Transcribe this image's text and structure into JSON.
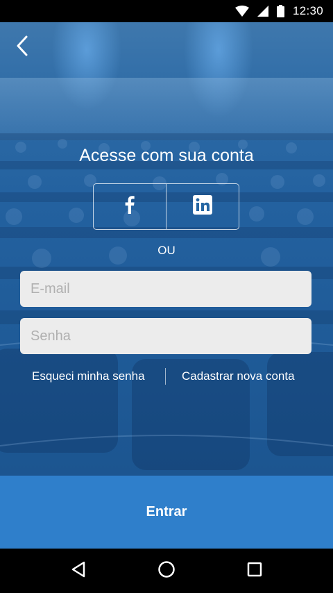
{
  "status_bar": {
    "time": "12:30",
    "icons": [
      "wifi-icon",
      "cell-signal-icon",
      "battery-icon"
    ]
  },
  "header": {
    "back_icon": "chevron-left-icon"
  },
  "login": {
    "title": "Acesse com sua conta",
    "social": {
      "facebook_icon": "facebook-icon",
      "linkedin_icon": "linkedin-icon"
    },
    "or_label": "OU",
    "email": {
      "value": "",
      "placeholder": "E-mail"
    },
    "password": {
      "value": "",
      "placeholder": "Senha"
    },
    "forgot_label": "Esqueci minha senha",
    "register_label": "Cadastrar nova conta",
    "submit_label": "Entrar"
  },
  "nav_bar": {
    "icons": [
      "back-triangle-icon",
      "home-circle-icon",
      "recents-square-icon"
    ]
  },
  "colors": {
    "overlay_blue": "#2566a3",
    "submit_blue": "#2f7fcb",
    "field_bg": "#ececec",
    "placeholder": "#b0b0b0"
  }
}
